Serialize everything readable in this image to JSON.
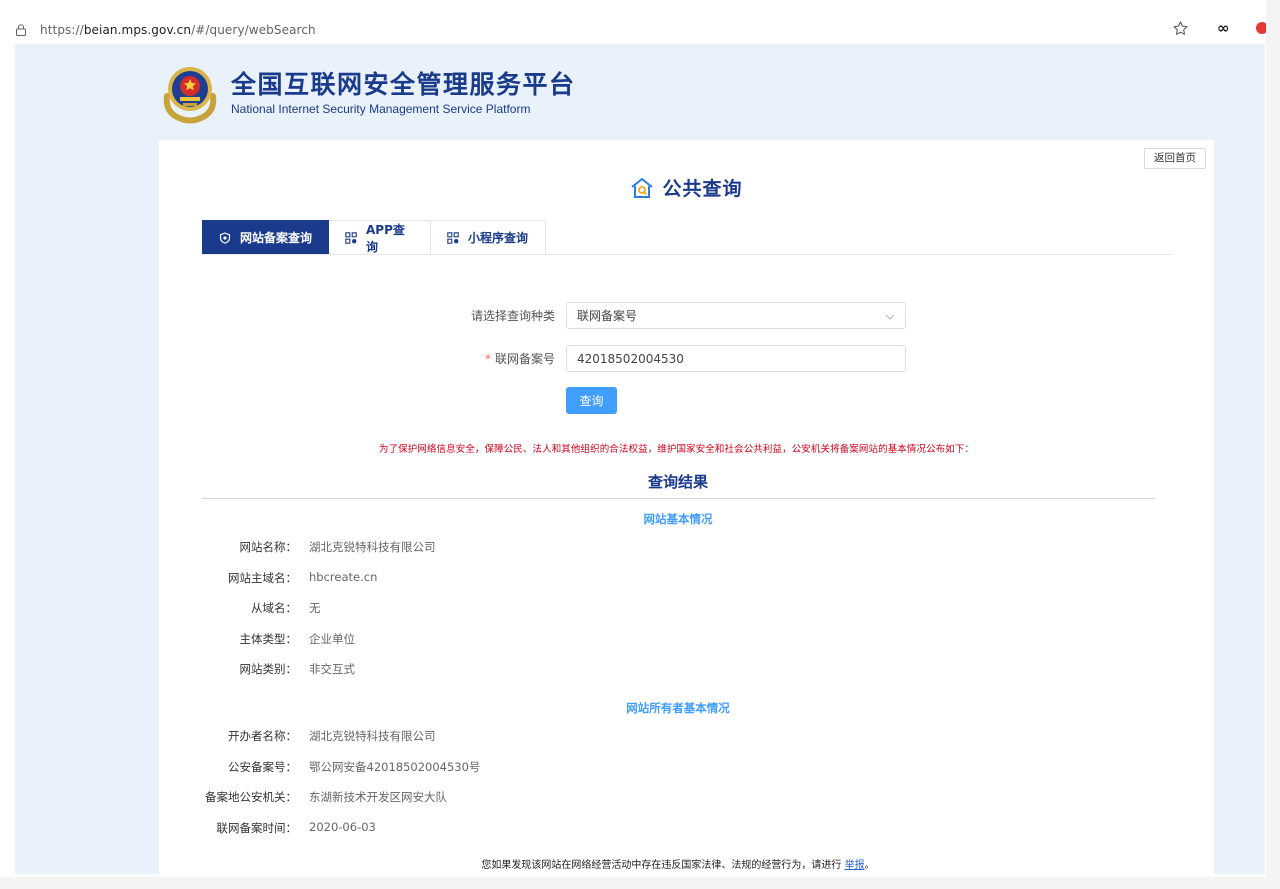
{
  "browser": {
    "url_prefix": "https://",
    "url_host": "beian.mps.gov.cn",
    "url_path": "/#/query/webSearch",
    "extension_label": "∞"
  },
  "header": {
    "title_cn": "全国互联网安全管理服务平台",
    "title_en": "National Internet Security Management Service Platform"
  },
  "back_button": "返回首页",
  "page_title": "公共查询",
  "tabs": [
    {
      "label": "网站备案查询",
      "active": true
    },
    {
      "label": "APP查询",
      "active": false
    },
    {
      "label": "小程序查询",
      "active": false
    }
  ],
  "form": {
    "type_label": "请选择查询种类",
    "type_value": "联网备案号",
    "id_required_mark": "*",
    "id_label": "联网备案号",
    "id_value": "42018502004530",
    "submit_label": "查询"
  },
  "notice": "为了保护网络信息安全，保障公民、法人和其他组织的合法权益，维护国家安全和社会公共利益，公安机关将备案网站的基本情况公布如下：",
  "result_title": "查询结果",
  "website_section": {
    "title": "网站基本情况",
    "fields": [
      {
        "key": "网站名称：",
        "value": "湖北克锐特科技有限公司"
      },
      {
        "key": "网站主域名：",
        "value": "hbcreate.cn"
      },
      {
        "key": "从域名：",
        "value": "无"
      },
      {
        "key": "主体类型：",
        "value": "企业单位"
      },
      {
        "key": "网站类别：",
        "value": "非交互式"
      }
    ]
  },
  "owner_section": {
    "title": "网站所有者基本情况",
    "fields": [
      {
        "key": "开办者名称：",
        "value": "湖北克锐特科技有限公司"
      },
      {
        "key": "公安备案号：",
        "value": "鄂公网安备42018502004530号"
      },
      {
        "key": "备案地公安机关：",
        "value": "东湖新技术开发区网安大队"
      },
      {
        "key": "联网备案时间：",
        "value": "2020-06-03"
      }
    ]
  },
  "footer": {
    "text": "您如果发现该网站在网络经营活动中存在违反国家法律、法规的经营行为，请进行 ",
    "link": "举报",
    "end": "。"
  },
  "colors": {
    "brand_blue": "#1a3a8c",
    "accent_blue": "#409eff",
    "notice_red": "#d0021b",
    "page_bg": "#e9f1fb"
  }
}
